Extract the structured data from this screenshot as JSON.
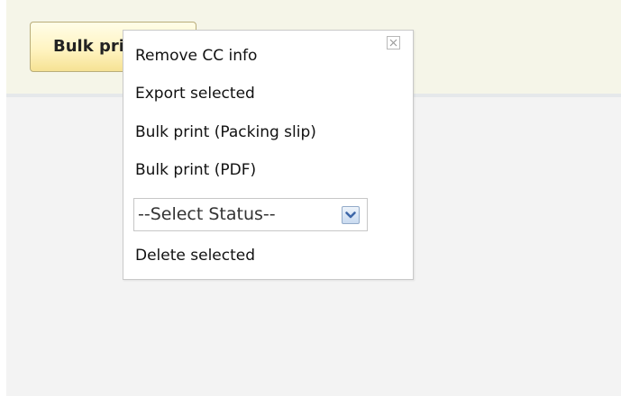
{
  "toolbar": {
    "bulk_button_label": "Bulk print"
  },
  "popup": {
    "close_icon": "close-icon",
    "items": [
      {
        "label": "Remove CC info"
      },
      {
        "label": "Export selected"
      },
      {
        "label": "Bulk print (Packing slip)"
      },
      {
        "label": "Bulk print (PDF)"
      },
      {
        "label": "Delete selected"
      }
    ],
    "status_select": {
      "value": "--Select Status--",
      "arrow_icon": "chevron-down-icon"
    }
  },
  "colors": {
    "toolbar_background": "#f5f5e8",
    "button_gradient_top": "#fffde8",
    "button_gradient_bottom": "#f6e294",
    "select_arrow_blue": "#3e67a8"
  }
}
